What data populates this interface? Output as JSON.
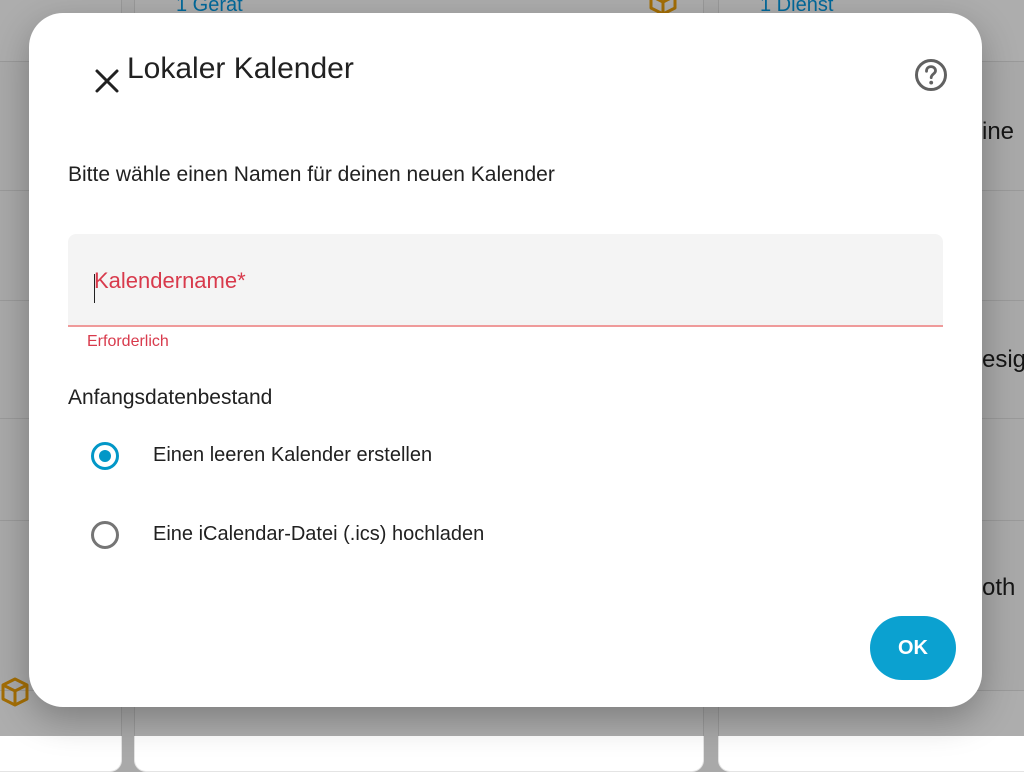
{
  "background": {
    "card_links": [
      "1 Gerät",
      "1 Dienst"
    ],
    "partial_texts": [
      "ine",
      "esig",
      "oth"
    ],
    "icon": "package-icon"
  },
  "dialog": {
    "title": "Lokaler Kalender",
    "close_icon": "close-icon",
    "help_icon": "help-circle-icon",
    "description": "Bitte wähle einen Namen für deinen neuen Kalender",
    "name_field": {
      "label": "Kalendername*",
      "value": "",
      "helper": "Erforderlich"
    },
    "initial_data": {
      "label": "Anfangsdatenbestand",
      "options": [
        {
          "label": "Einen leeren Kalender erstellen",
          "checked": true
        },
        {
          "label": "Eine iCalendar-Datei (.ics) hochladen",
          "checked": false
        }
      ]
    },
    "ok_label": "OK"
  },
  "colors": {
    "accent": "#0297c7",
    "ok_button": "#0ba1d0",
    "error": "#d83a4c",
    "bg_link": "#039be5",
    "bg_icon": "#f0a30a"
  }
}
